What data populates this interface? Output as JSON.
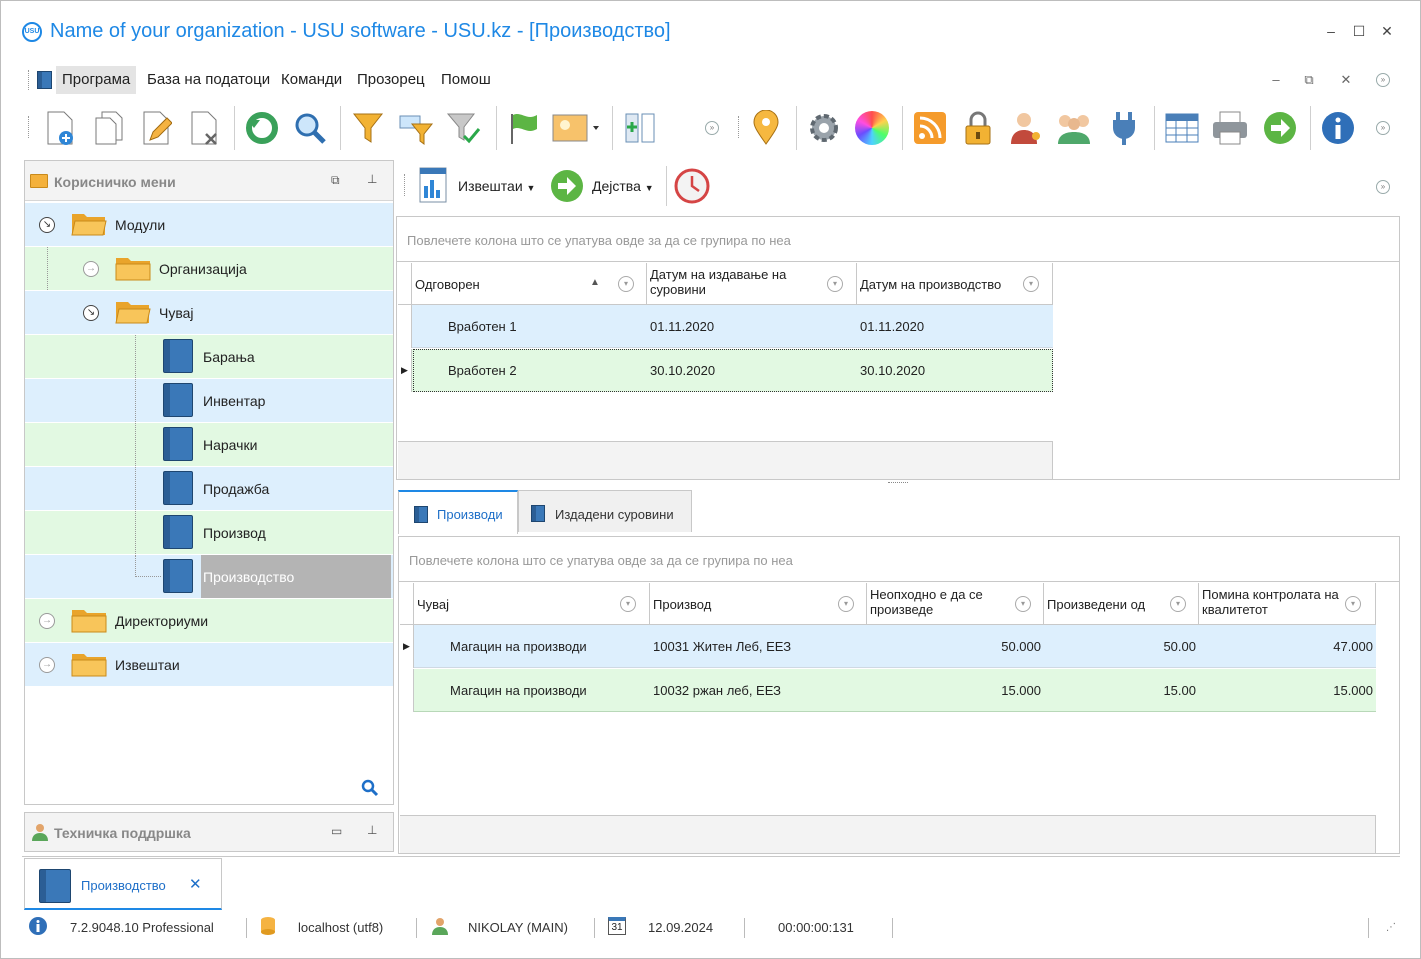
{
  "window": {
    "title": "Name of your organization - USU software - USU.kz - [Производство]",
    "logo_text": "USU"
  },
  "menu": {
    "items": [
      "Програма",
      "База на податоци",
      "Команди",
      "Прозорец",
      "Помош"
    ]
  },
  "left_panel": {
    "title": "Корисничко мени",
    "tree": [
      {
        "label": "Модули",
        "type": "folder",
        "level": 0
      },
      {
        "label": "Организација",
        "type": "folder",
        "level": 1
      },
      {
        "label": "Чувај",
        "type": "folder",
        "level": 1
      },
      {
        "label": "Барања",
        "type": "book",
        "level": 2
      },
      {
        "label": "Инвентар",
        "type": "book",
        "level": 2
      },
      {
        "label": "Нарачки",
        "type": "book",
        "level": 2
      },
      {
        "label": "Продажба",
        "type": "book",
        "level": 2
      },
      {
        "label": "Производ",
        "type": "book",
        "level": 2
      },
      {
        "label": "Производство",
        "type": "book",
        "level": 2,
        "selected": true
      },
      {
        "label": "Директориуми",
        "type": "folder",
        "level": 0
      },
      {
        "label": "Извештаи",
        "type": "folder",
        "level": 0
      }
    ]
  },
  "support_panel": {
    "title": "Техничка поддршка"
  },
  "right_toolbar": {
    "reports_label": "Извештаи",
    "actions_label": "Дејства"
  },
  "top_grid": {
    "group_hint": "Повлечете колона што се упатува овде за да се групира по неа",
    "columns": [
      "Одговорен",
      "Датум на издавање на суровини",
      "Датум на производство"
    ],
    "rows": [
      {
        "responsible": "Вработен 1",
        "issue_date": "01.11.2020",
        "production_date": "01.11.2020"
      },
      {
        "responsible": "Вработен 2",
        "issue_date": "30.10.2020",
        "production_date": "30.10.2020"
      }
    ]
  },
  "tabs": [
    "Производи",
    "Издадени суровини"
  ],
  "bottom_grid": {
    "group_hint": "Повлечете колона што се упатува овде за да се групира по неа",
    "columns": [
      "Чувај",
      "Производ",
      "Неопходно е да се произведе",
      "Произведени од",
      "Помина контролата на квалитетот"
    ],
    "rows": [
      {
        "store": "Магацин на производи",
        "product": "10031 Житен Леб, ЕЕЗ",
        "required": "50.000",
        "produced": "50.00",
        "passed": "47.000"
      },
      {
        "store": "Магацин на производи",
        "product": "10032 ржан леб, ЕЕЗ",
        "required": "15.000",
        "produced": "15.00",
        "passed": "15.000"
      }
    ]
  },
  "doc_tab": {
    "label": "Производство"
  },
  "status": {
    "version": "7.2.9048.10 Professional",
    "server": "localhost (utf8)",
    "user": "NIKOLAY (MAIN)",
    "calendar_day": "31",
    "date": "12.09.2024",
    "timer": "00:00:00:131"
  },
  "colors": {
    "accent": "#1e88e5",
    "row_blue": "#ddeffd",
    "row_green": "#e2f9e2",
    "selected_gray": "#b4b4b4"
  }
}
